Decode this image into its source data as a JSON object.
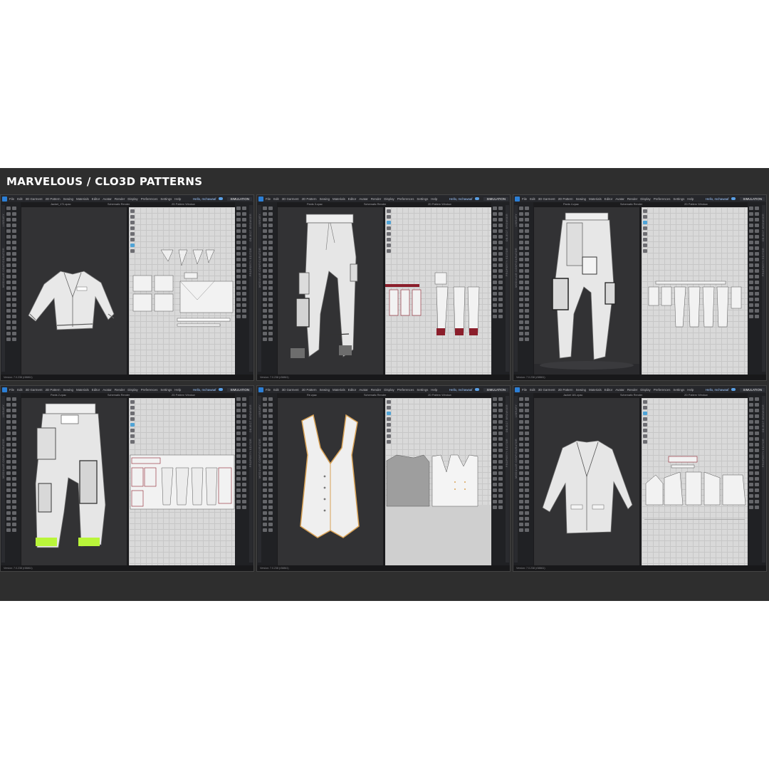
{
  "title": "MARVELOUS / CLO3D PATTERNS",
  "menu": [
    "File",
    "Edit",
    "3D Garment",
    "2D Pattern",
    "Sewing",
    "Materials",
    "Editor",
    "Avatar",
    "Render",
    "Display",
    "Preferences",
    "Settings",
    "Help"
  ],
  "user": "Hello, mchawaaf",
  "simulation": "SIMULATION",
  "view3d_label": "Schematic Render",
  "view2d_label": "2D Pattern Window",
  "left_tab_1": "LIBRARY",
  "left_tab_2": "MODULAR CONFIGURATOR",
  "right_tab_1": "OBJECT BROWSER",
  "right_tab_2": "PROPERTY EDITOR",
  "status_text": "Version: 7.0.238 (r38861)",
  "windows": [
    {
      "file": "Jacket_171.zpac",
      "garment": "jacket"
    },
    {
      "file": "Pants 3.zpac",
      "garment": "pants"
    },
    {
      "file": "Pants 4.zpac",
      "garment": "cargo"
    },
    {
      "file": "Pants 2.zpac",
      "garment": "cargo-green"
    },
    {
      "file": "Re.zpac",
      "garment": "vest"
    },
    {
      "file": "Jacket 181.zpac",
      "garment": "blazer"
    }
  ],
  "colors": {
    "background": "#2e2e2e",
    "accent": "#2c7fd6",
    "pattern_red": "#8b1e2b",
    "cuff_green": "#b9f53a",
    "piping_orange": "#d9a255"
  }
}
